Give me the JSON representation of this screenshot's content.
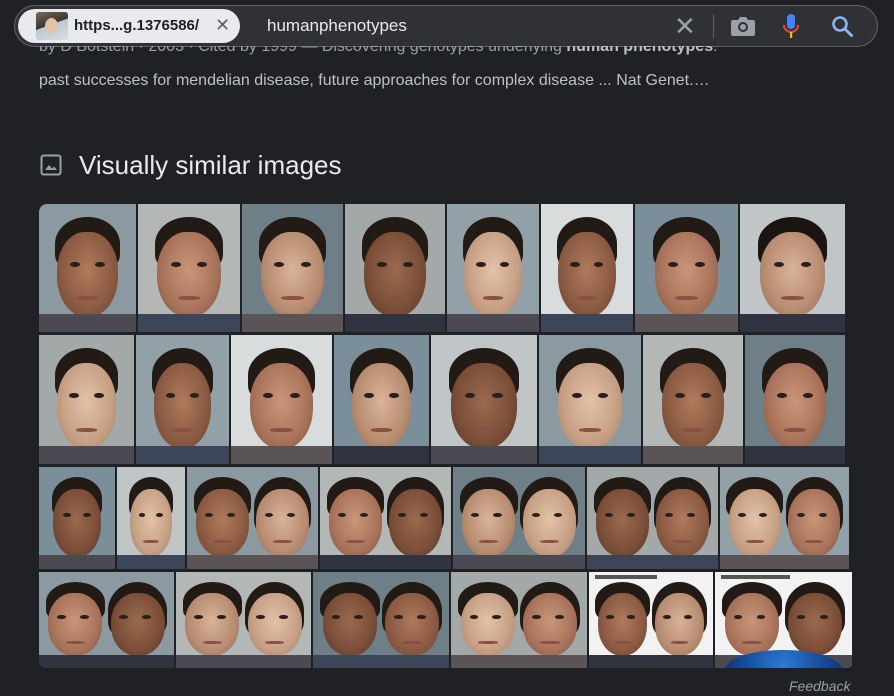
{
  "search": {
    "chip_url": "https...g.1376586/",
    "query": "humanphenotypes"
  },
  "result": {
    "meta_line_prefix": "by D Botstein · 2003 · Cited by 1999 — Discovering genotypes underlying ",
    "meta_line_bold": "human phenotypes",
    "meta_line_suffix": ":",
    "snippet": "past successes for mendelian disease, future approaches for complex disease ... Nat Genet.…"
  },
  "section": {
    "title": "Visually similar images",
    "icon": "image-icon"
  },
  "footer": {
    "feedback": "Feedback"
  },
  "colors": {
    "background": "#202124",
    "searchbar": "#303134",
    "chip": "#e8eaed",
    "mic_blue": "#4285f4",
    "mic_red": "#ea4335",
    "search_blue": "#8ab4f8"
  }
}
